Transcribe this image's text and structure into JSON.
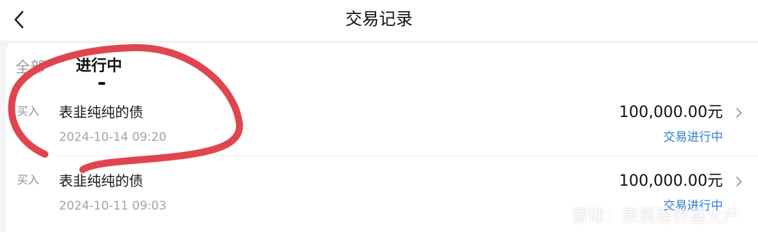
{
  "header": {
    "title": "交易记录"
  },
  "tabs": [
    {
      "label": "全部",
      "active": false
    },
    {
      "label": "进行中",
      "active": true
    }
  ],
  "records": [
    {
      "type": "买入",
      "name": "表韭纯纯的债",
      "time": "2024-10-14 09:20",
      "amount": "100,000.00元",
      "status": "交易进行中"
    },
    {
      "type": "买入",
      "name": "表韭纯纯的债",
      "time": "2024-10-11 09:03",
      "amount": "100,000.00元",
      "status": "交易进行中"
    }
  ],
  "watermark": {
    "text": "雪球：表舅是养基大户"
  },
  "colors": {
    "background": "#f4f4f6",
    "status": "#2f7fd1",
    "annotation": "#e0454f"
  }
}
